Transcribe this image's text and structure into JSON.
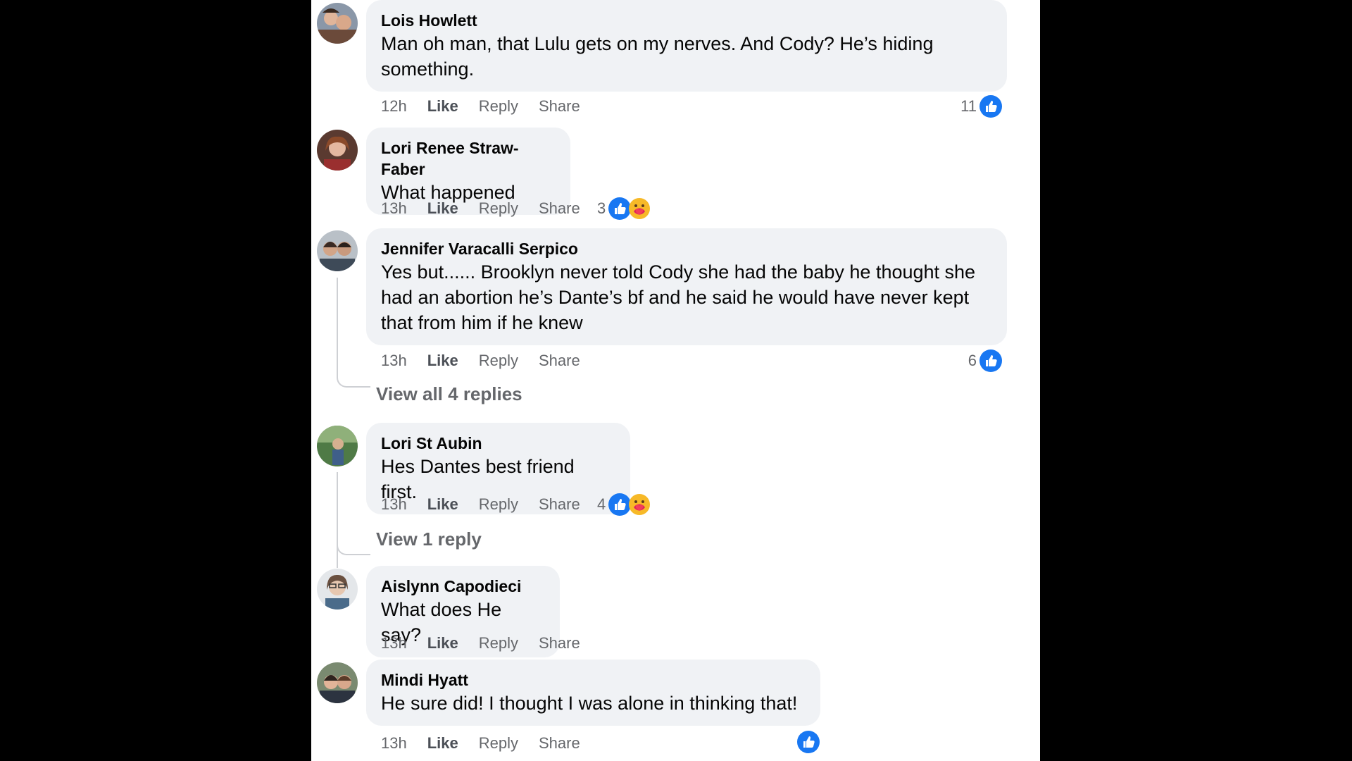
{
  "colors": {
    "like_blue": "#1877f2",
    "bubble_bg": "#f0f2f5",
    "secondary_text": "#65676b",
    "care_yellow": "#f7b928"
  },
  "actions": {
    "like": "Like",
    "reply": "Reply",
    "share": "Share"
  },
  "comments": [
    {
      "author": "Lois Howlett",
      "text": "Man oh man, that Lulu gets on my nerves. And Cody? He’s hiding something.",
      "time": "12h",
      "reaction_count": "11",
      "reactions": [
        "like"
      ]
    },
    {
      "author": "Lori Renee Straw-Faber",
      "text": "What happened",
      "time": "13h",
      "reaction_count": "3",
      "reactions": [
        "like",
        "care"
      ]
    },
    {
      "author": "Jennifer Varacalli Serpico",
      "text": "Yes but...... Brooklyn never told Cody she had the baby he thought she had an abortion he’s Dante’s bf and he said he would have never kept that from him if he knew",
      "time": "13h",
      "reaction_count": "6",
      "reactions": [
        "like"
      ],
      "view_replies": "View all 4 replies"
    },
    {
      "author": "Lori St Aubin",
      "text": "Hes Dantes best friend first.",
      "time": "13h",
      "reaction_count": "4",
      "reactions": [
        "like",
        "care"
      ],
      "view_replies": "View 1 reply"
    },
    {
      "author": "Aislynn Capodieci",
      "text": "What does He say?",
      "time": "13h"
    },
    {
      "author": "Mindi Hyatt",
      "text": "He sure did! I thought I was alone in thinking that!",
      "time": "13h",
      "reactions": [
        "like"
      ]
    }
  ]
}
